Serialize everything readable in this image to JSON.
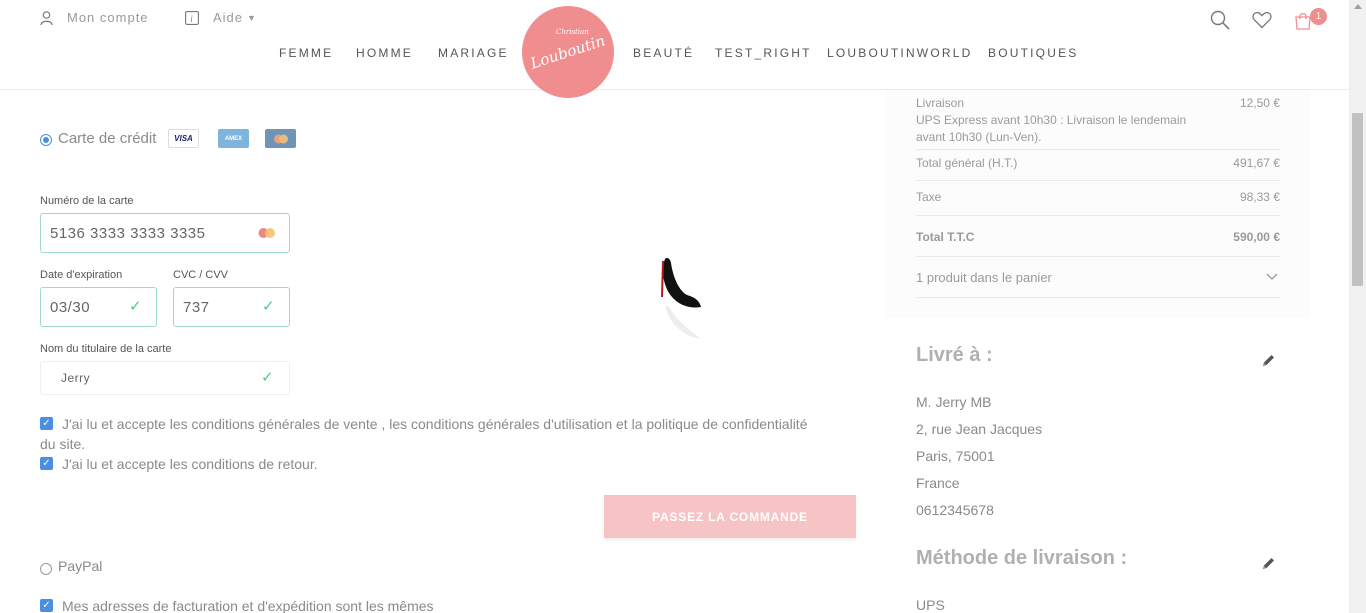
{
  "header": {
    "account_label": "Mon compte",
    "help_label": "Aide",
    "nav": [
      "FEMME",
      "HOMME",
      "MARIAGE",
      "BEAUTÉ",
      "TEST_RIGHT",
      "LOUBOUTINWORLD",
      "BOUTIQUES"
    ],
    "logo_text": "Louboutin",
    "logo_sub": "Christian",
    "cart_count": "1"
  },
  "payment": {
    "credit_card_label": "Carte de crédit",
    "card_brands": [
      "VISA",
      "AMEX",
      "MC"
    ],
    "card_number_label": "Numéro de la carte",
    "card_number_value": "5136 3333 3333 3335",
    "expiry_label": "Date d'expiration",
    "expiry_value": "03/30",
    "cvc_label": "CVC / CVV",
    "cvc_value": "737",
    "holder_label": "Nom du titulaire de la carte",
    "holder_value": "Jerry",
    "terms_line1": "J'ai lu et accepte les conditions générales de vente , les conditions générales d'utilisation et la politique de confidentialité",
    "terms_line2": "du site.",
    "returns_text": "J'ai lu et accepte les conditions de retour.",
    "order_button": "PASSEZ LA COMMANDE",
    "paypal_label": "PayPal",
    "same_address_text": "Mes adresses de facturation et d'expédition sont les mêmes"
  },
  "summary": {
    "shipping_label": "Livraison",
    "shipping_value": "12,50 €",
    "shipping_desc_1": "UPS Express avant 10h30 : Livraison le lendemain",
    "shipping_desc_2": "avant 10h30 (Lun-Ven).",
    "subtotal_label": "Total général (H.T.)",
    "subtotal_value": "491,67 €",
    "tax_label": "Taxe",
    "tax_value": "98,33 €",
    "total_label": "Total T.T.C",
    "total_value": "590,00 €",
    "cart_items": "1 produit dans le panier"
  },
  "delivery": {
    "title": "Livré à :",
    "name": "M. Jerry MB",
    "street": "2, rue Jean Jacques",
    "city": "Paris, 75001",
    "country": "France",
    "phone": "0612345678"
  },
  "shipping_method": {
    "title": "Méthode de livraison :",
    "carrier": "UPS"
  }
}
